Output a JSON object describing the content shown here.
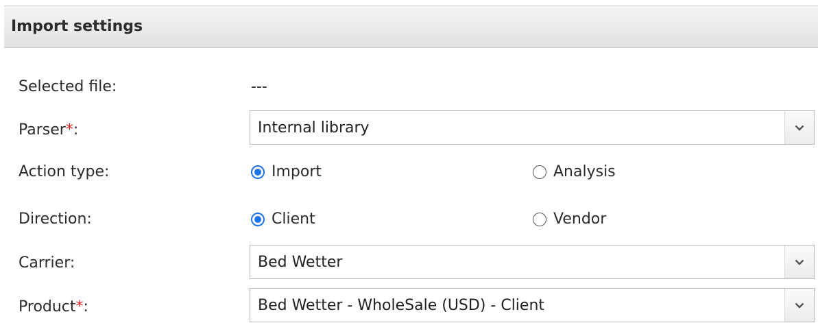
{
  "panel": {
    "title": "Import settings"
  },
  "selected_file": {
    "label": "Selected file:",
    "value": "---"
  },
  "parser": {
    "label": "Parser",
    "required_mark": "*",
    "suffix": ":",
    "value": "Internal library"
  },
  "action_type": {
    "label": "Action type:",
    "options": [
      {
        "label": "Import",
        "selected": true
      },
      {
        "label": "Analysis",
        "selected": false
      }
    ]
  },
  "direction": {
    "label": "Direction:",
    "options": [
      {
        "label": "Client",
        "selected": true
      },
      {
        "label": "Vendor",
        "selected": false
      }
    ]
  },
  "carrier": {
    "label": "Carrier:",
    "value": "Bed Wetter"
  },
  "product": {
    "label": "Product",
    "required_mark": "*",
    "suffix": ":",
    "value": "Bed Wetter - WholeSale (USD) - Client"
  },
  "colors": {
    "accent": "#1a73e8",
    "required": "#e02020",
    "header_bg": "#e8e8e8"
  },
  "icons": {
    "dropdown": "chevron-down-icon",
    "radio_on": "radio-checked-icon",
    "radio_off": "radio-unchecked-icon"
  }
}
